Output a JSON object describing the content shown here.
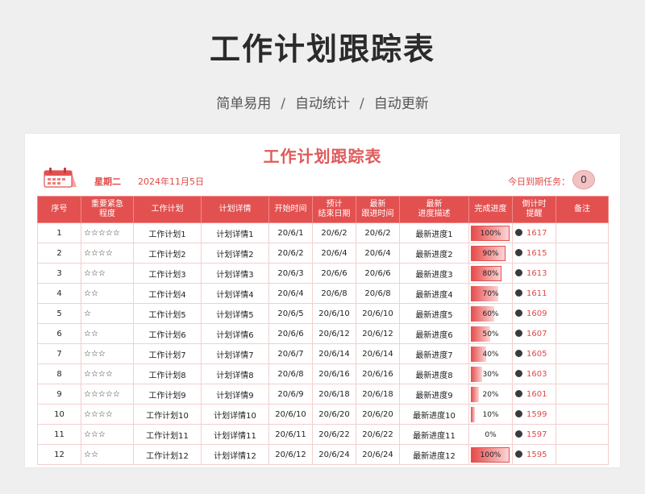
{
  "header": {
    "title": "工作计划跟踪表",
    "subtitle": [
      "简单易用",
      "自动统计",
      "自动更新"
    ],
    "separator": "/"
  },
  "sheet": {
    "title": "工作计划跟踪表",
    "weekday": "星期二",
    "date": "2024年11月5日",
    "due_label": "今日到期任务：",
    "due_count": "0"
  },
  "colors": {
    "accent": "#e35050",
    "text_red": "#e04848",
    "badge": "#f2c2c2"
  },
  "table": {
    "headers": [
      "序号",
      "重要紧急\n程度",
      "工作计划",
      "计划详情",
      "开始时间",
      "预计\n结束日期",
      "最新\n跟进时间",
      "最新\n进度描述",
      "完成进度",
      "倒计时\n提醒",
      "备注"
    ],
    "rows": [
      {
        "no": "1",
        "stars": "☆☆☆☆☆",
        "plan": "工作计划1",
        "detail": "计划详情1",
        "start": "20/6/1",
        "end": "20/6/2",
        "follow": "20/6/2",
        "progress_desc": "最新进度1",
        "progress": "100%",
        "progress_value": 100,
        "remind": "1617"
      },
      {
        "no": "2",
        "stars": "☆☆☆☆",
        "plan": "工作计划2",
        "detail": "计划详情2",
        "start": "20/6/2",
        "end": "20/6/4",
        "follow": "20/6/4",
        "progress_desc": "最新进度2",
        "progress": "90%",
        "progress_value": 90,
        "remind": "1615"
      },
      {
        "no": "3",
        "stars": "☆☆☆",
        "plan": "工作计划3",
        "detail": "计划详情3",
        "start": "20/6/3",
        "end": "20/6/6",
        "follow": "20/6/6",
        "progress_desc": "最新进度3",
        "progress": "80%",
        "progress_value": 80,
        "remind": "1613"
      },
      {
        "no": "4",
        "stars": "☆☆",
        "plan": "工作计划4",
        "detail": "计划详情4",
        "start": "20/6/4",
        "end": "20/6/8",
        "follow": "20/6/8",
        "progress_desc": "最新进度4",
        "progress": "70%",
        "progress_value": 70,
        "remind": "1611"
      },
      {
        "no": "5",
        "stars": "☆",
        "plan": "工作计划5",
        "detail": "计划详情5",
        "start": "20/6/5",
        "end": "20/6/10",
        "follow": "20/6/10",
        "progress_desc": "最新进度5",
        "progress": "60%",
        "progress_value": 60,
        "remind": "1609"
      },
      {
        "no": "6",
        "stars": "☆☆",
        "plan": "工作计划6",
        "detail": "计划详情6",
        "start": "20/6/6",
        "end": "20/6/12",
        "follow": "20/6/12",
        "progress_desc": "最新进度6",
        "progress": "50%",
        "progress_value": 50,
        "remind": "1607"
      },
      {
        "no": "7",
        "stars": "☆☆☆",
        "plan": "工作计划7",
        "detail": "计划详情7",
        "start": "20/6/7",
        "end": "20/6/14",
        "follow": "20/6/14",
        "progress_desc": "最新进度7",
        "progress": "40%",
        "progress_value": 40,
        "remind": "1605"
      },
      {
        "no": "8",
        "stars": "☆☆☆☆",
        "plan": "工作计划8",
        "detail": "计划详情8",
        "start": "20/6/8",
        "end": "20/6/16",
        "follow": "20/6/16",
        "progress_desc": "最新进度8",
        "progress": "30%",
        "progress_value": 30,
        "remind": "1603"
      },
      {
        "no": "9",
        "stars": "☆☆☆☆☆",
        "plan": "工作计划9",
        "detail": "计划详情9",
        "start": "20/6/9",
        "end": "20/6/18",
        "follow": "20/6/18",
        "progress_desc": "最新进度9",
        "progress": "20%",
        "progress_value": 20,
        "remind": "1601"
      },
      {
        "no": "10",
        "stars": "☆☆☆☆",
        "plan": "工作计划10",
        "detail": "计划详情10",
        "start": "20/6/10",
        "end": "20/6/20",
        "follow": "20/6/20",
        "progress_desc": "最新进度10",
        "progress": "10%",
        "progress_value": 10,
        "remind": "1599"
      },
      {
        "no": "11",
        "stars": "☆☆☆",
        "plan": "工作计划11",
        "detail": "计划详情11",
        "start": "20/6/11",
        "end": "20/6/22",
        "follow": "20/6/22",
        "progress_desc": "最新进度11",
        "progress": "0%",
        "progress_value": 0,
        "remind": "1597"
      },
      {
        "no": "12",
        "stars": "☆☆",
        "plan": "工作计划12",
        "detail": "计划详情12",
        "start": "20/6/12",
        "end": "20/6/24",
        "follow": "20/6/24",
        "progress_desc": "最新进度12",
        "progress": "100%",
        "progress_value": 100,
        "remind": "1595"
      }
    ]
  }
}
